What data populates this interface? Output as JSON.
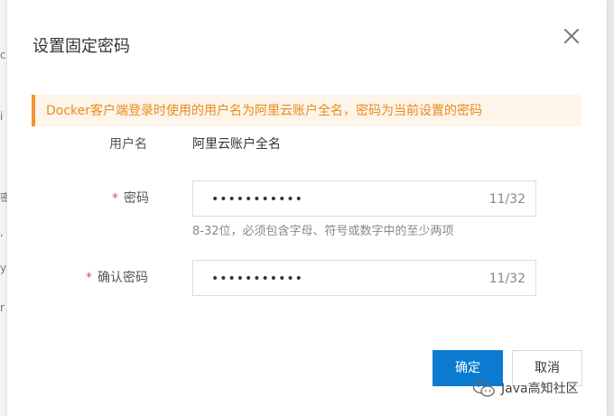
{
  "background": {
    "chars": [
      "c",
      "i",
      "密",
      ",",
      "y",
      "r"
    ]
  },
  "dialog": {
    "title": "设置固定密码",
    "close_icon": "close-icon"
  },
  "notice": {
    "text": "Docker客户端登录时使用的用户名为阿里云账户全名，密码为当前设置的密码",
    "accent_color": "#f29330"
  },
  "form": {
    "username": {
      "label": "用户名",
      "value": "阿里云账户全名"
    },
    "password": {
      "required_mark": "*",
      "label": "密码",
      "masked_value": "•••••••••••",
      "counter": "11/32",
      "hint": "8-32位，必须包含字母、符号或数字中的至少两项"
    },
    "confirm_password": {
      "required_mark": "*",
      "label": "确认密码",
      "masked_value": "•••••••••••",
      "counter": "11/32"
    }
  },
  "buttons": {
    "confirm": "确定",
    "cancel": "取消",
    "primary_color": "#0b7bd2"
  },
  "watermark": {
    "icon": "wechat-icon",
    "text": "Java高知社区"
  }
}
